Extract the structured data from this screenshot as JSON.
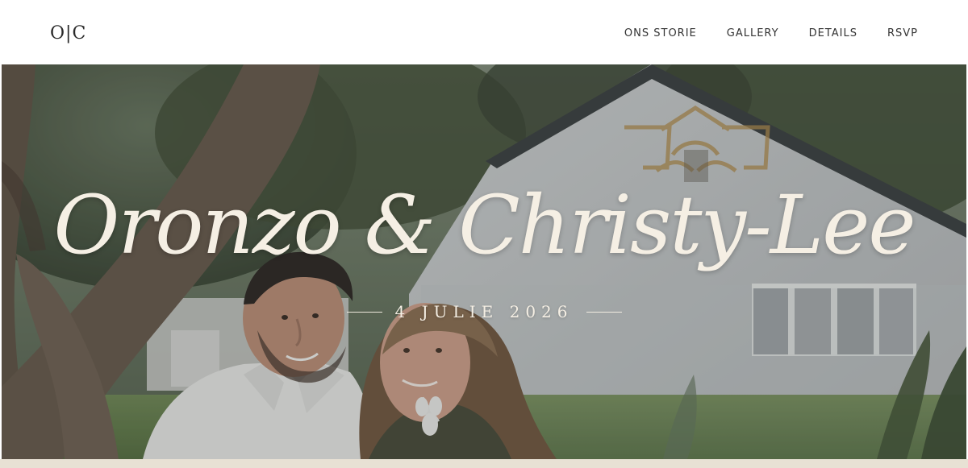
{
  "header": {
    "logo": "O|C",
    "nav": [
      {
        "label": "ONS STORIE"
      },
      {
        "label": "GALLERY"
      },
      {
        "label": "DETAILS"
      },
      {
        "label": "RSVP"
      }
    ]
  },
  "hero": {
    "title": "Oronzo & Christy-Lee",
    "date": "4 JULIE 2026"
  },
  "colors": {
    "header_bg": "#ffffff",
    "text": "#333333",
    "hero_text": "#f5efe4",
    "footer_strip": "#e8e1d4"
  }
}
